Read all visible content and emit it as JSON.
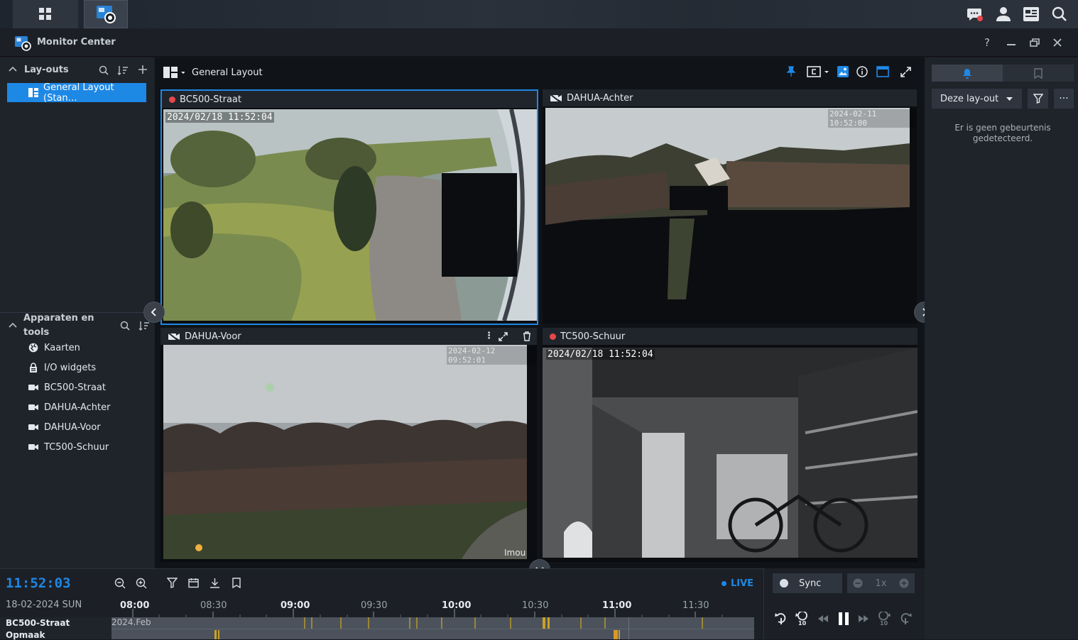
{
  "app": {
    "title": "Monitor Center"
  },
  "layouts": {
    "heading": "Lay-outs",
    "active_item": "General Layout (Stan…"
  },
  "devices": {
    "heading_line1": "Apparaten en",
    "heading_line2": "tools",
    "items": [
      {
        "label": "Kaarten",
        "icon": "map-icon"
      },
      {
        "label": "I/O widgets",
        "icon": "io-widget-icon"
      },
      {
        "label": "BC500-Straat",
        "icon": "camera-icon"
      },
      {
        "label": "DAHUA-Achter",
        "icon": "camera-icon"
      },
      {
        "label": "DAHUA-Voor",
        "icon": "camera-icon"
      },
      {
        "label": "TC500-Schuur",
        "icon": "camera-icon"
      }
    ]
  },
  "toolbar": {
    "layout_name": "General Layout"
  },
  "cameras": [
    {
      "name": "BC500-Straat",
      "timestamp": "2024/02/18 11:52:04"
    },
    {
      "name": "DAHUA-Achter",
      "timestamp": "2024-02-11 10:52:00"
    },
    {
      "name": "DAHUA-Voor",
      "timestamp": "2024-02-12 09:52:01",
      "watermark": "Imou"
    },
    {
      "name": "TC500-Schuur",
      "timestamp": "2024/02/18 11:52:04"
    }
  ],
  "events": {
    "filter_label": "Deze lay-out",
    "empty_text_line1": "Er is geen gebeurtenis",
    "empty_text_line2": "gedetecteerd."
  },
  "timeline": {
    "clock": "11:52:03",
    "date": "18-02-2024 SUN",
    "live": "LIVE",
    "ticks": [
      "08:00",
      "08:30",
      "09:00",
      "09:30",
      "10:00",
      "10:30",
      "11:00",
      "11:30"
    ],
    "month_label": "2024.Feb",
    "row1": "BC500-Straat",
    "row2": "Opmaak",
    "sync": "Sync",
    "speed": "1x"
  },
  "colors": {
    "accent": "#1e88e5",
    "record": "#e8484b",
    "event": "#c9a227"
  }
}
